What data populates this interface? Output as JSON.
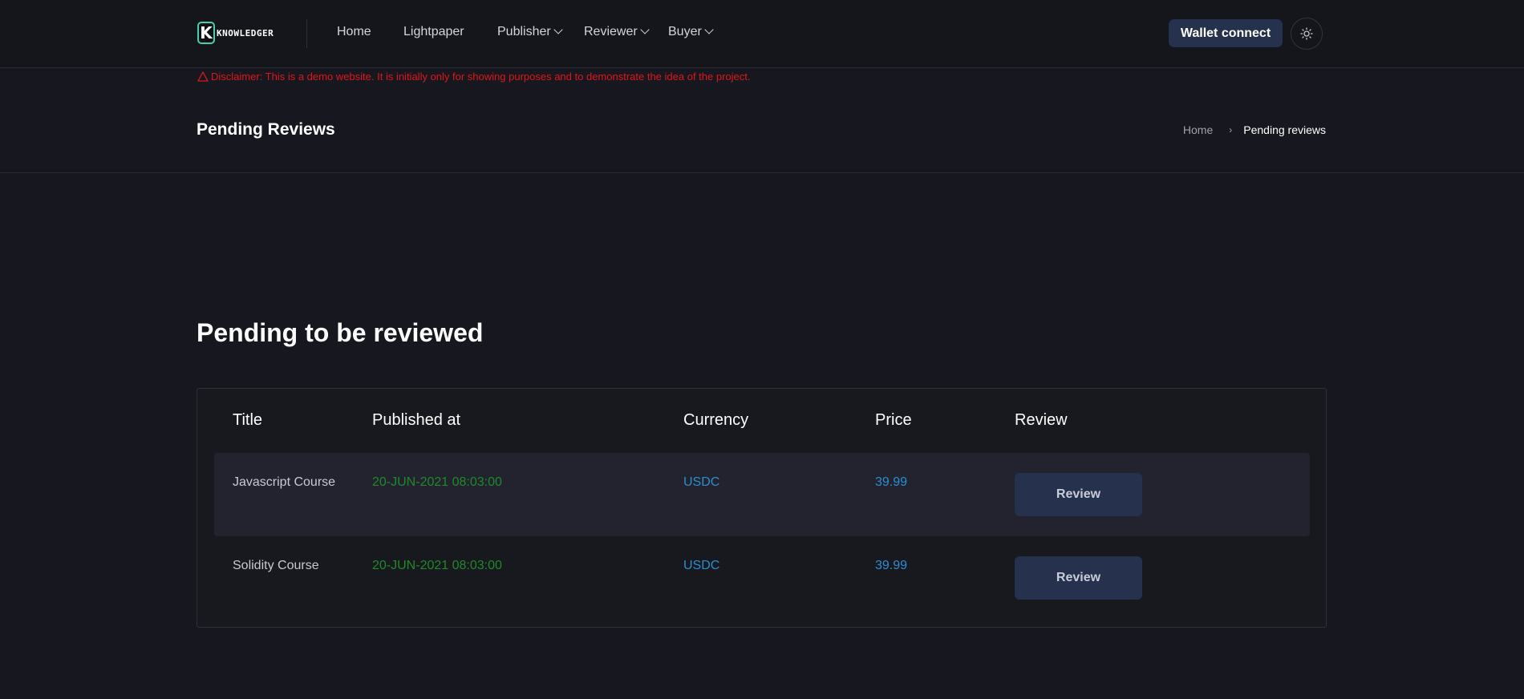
{
  "brand": {
    "logo_letter": "K",
    "logo_text": "KNOWLEDGER"
  },
  "nav": {
    "items": [
      {
        "label": "Home"
      },
      {
        "label": "Lightpaper"
      },
      {
        "label": "Publisher"
      },
      {
        "label": "Reviewer"
      },
      {
        "label": "Buyer"
      }
    ],
    "wallet_label": "Wallet connect"
  },
  "disclaimer": "Disclaimer: This is a demo website. It is initially only for showing purposes and to demonstrate the idea of the project.",
  "page": {
    "title": "Pending Reviews",
    "breadcrumb": {
      "home": "Home",
      "current": "Pending reviews"
    }
  },
  "section": {
    "title": "Pending to be reviewed"
  },
  "table": {
    "headers": [
      "Title",
      "Published at",
      "Currency",
      "Price",
      "Review"
    ],
    "rows": [
      {
        "title": "Javascript Course",
        "published_at": "20-JUN-2021 08:03:00",
        "currency": "USDC",
        "price": "39.99",
        "action": "Review"
      },
      {
        "title": "Solidity Course",
        "published_at": "20-JUN-2021 08:03:00",
        "currency": "USDC",
        "price": "39.99",
        "action": "Review"
      }
    ]
  },
  "colors": {
    "background": "#17171f",
    "accent_button": "#26314d",
    "date_green": "#1e8a2a",
    "link_blue": "#2a8fd0",
    "warning_red": "#e0161b"
  }
}
